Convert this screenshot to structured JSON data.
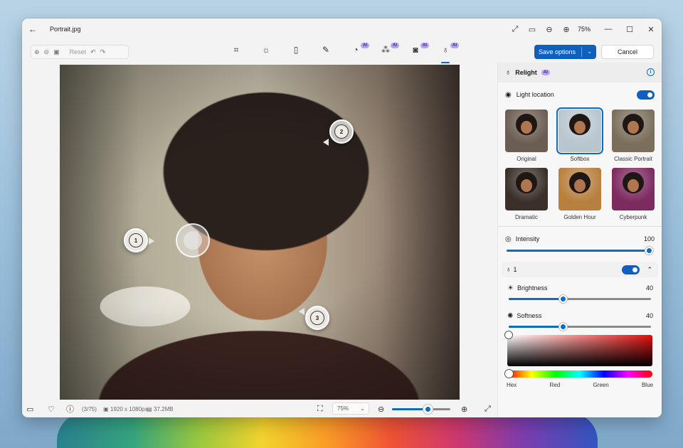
{
  "window": {
    "title": "Portrait.jpg",
    "zoom": "75%",
    "icons": [
      "back-arrow-icon",
      "expand-icon",
      "fit-icon",
      "zoom-out-icon",
      "zoom-in-icon",
      "minimize-icon",
      "maximize-icon",
      "close-icon"
    ]
  },
  "toolbar": {
    "reset_label": "Reset",
    "tools": [
      {
        "name": "crop",
        "ai": false
      },
      {
        "name": "adjust",
        "ai": false
      },
      {
        "name": "filter",
        "ai": false
      },
      {
        "name": "markup",
        "ai": false
      },
      {
        "name": "erase",
        "ai": true
      },
      {
        "name": "blur-background",
        "ai": true
      },
      {
        "name": "remove-background",
        "ai": true
      },
      {
        "name": "relight",
        "ai": true,
        "active": true
      }
    ],
    "ai_label": "AI",
    "save_label": "Save options",
    "cancel_label": "Cancel"
  },
  "canvas": {
    "markers": [
      "1",
      "2",
      "3"
    ]
  },
  "statusbar": {
    "index": "(3/75)",
    "dimensions": "1920 x 1080px",
    "size": "37.2MB",
    "zoom": "75%",
    "zoom_slider": 0.62
  },
  "panel": {
    "title": "Relight",
    "ai_label": "AI",
    "light_location_label": "Light location",
    "light_location_on": true,
    "presets": [
      {
        "label": "Original",
        "tint": "#6b5d52",
        "selected": false
      },
      {
        "label": "Softbox",
        "tint": "#b9c6cf",
        "selected": true
      },
      {
        "label": "Classic Portrait",
        "tint": "#7b6f5c",
        "selected": false
      },
      {
        "label": "Dramatic",
        "tint": "#3a2f2a",
        "selected": false
      },
      {
        "label": "Golden Hour",
        "tint": "#b7803f",
        "selected": false
      },
      {
        "label": "Cyberpunk",
        "tint": "#7d2a60",
        "selected": false
      }
    ],
    "intensity_label": "Intensity",
    "intensity_value": "100",
    "intensity": 1.0,
    "light1": {
      "label": "1",
      "on": true,
      "brightness_label": "Brightness",
      "brightness_value": "40",
      "brightness": 0.38,
      "softness_label": "Softness",
      "softness_value": "40",
      "softness": 0.38
    },
    "channels": [
      "Hex",
      "Red",
      "Green",
      "Blue"
    ]
  }
}
